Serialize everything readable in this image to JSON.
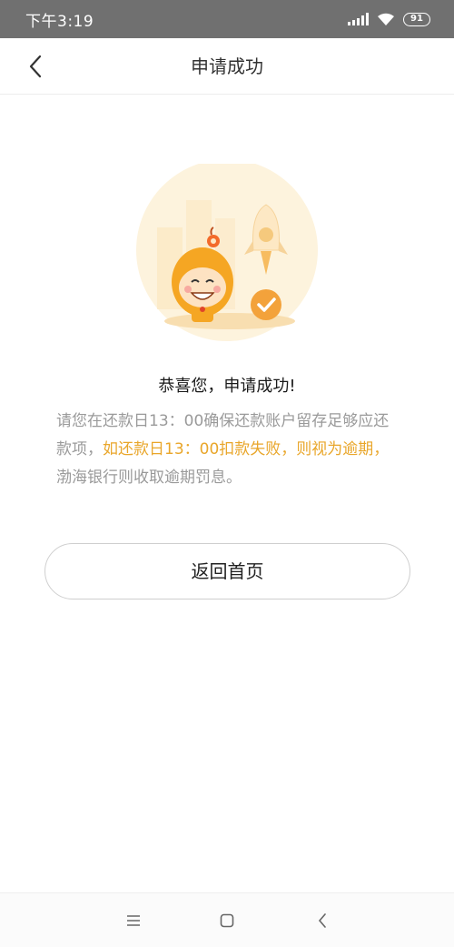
{
  "status_bar": {
    "time": "下午3:19",
    "battery": "91"
  },
  "header": {
    "title": "申请成功"
  },
  "success": {
    "title": "恭喜您，申请成功!",
    "notice_normal_1": "请您在还款日13：00确保还款账户留存足够应还款项，",
    "notice_warning": "如还款日13：00扣款失败，则视为逾期，",
    "notice_normal_2": "渤海银行则收取逾期罚息。"
  },
  "actions": {
    "home_label": "返回首页"
  },
  "colors": {
    "status_bar": "#707070",
    "warning_text": "#e9a62a",
    "body_text": "#9a9a9a",
    "illustration_accent": "#f3a23b"
  }
}
